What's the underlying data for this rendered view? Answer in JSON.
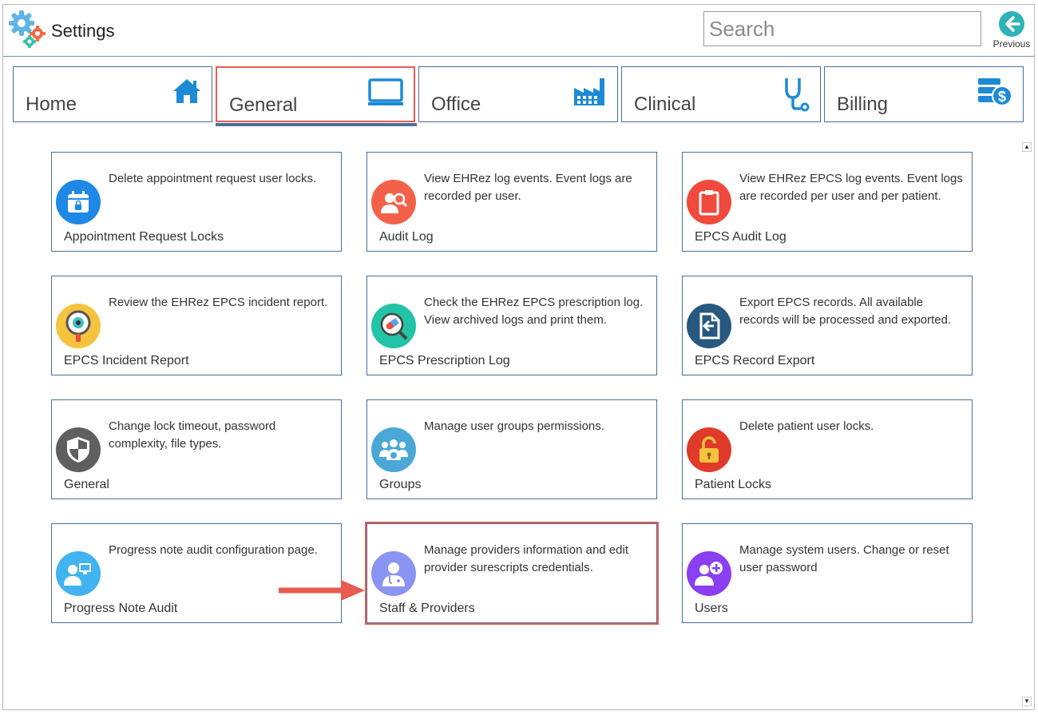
{
  "header": {
    "title": "Settings",
    "search_placeholder": "Search",
    "previous_label": "Previous"
  },
  "tabs": [
    {
      "label": "Home",
      "icon": "home-icon"
    },
    {
      "label": "General",
      "icon": "monitor-icon",
      "active": true
    },
    {
      "label": "Office",
      "icon": "factory-icon"
    },
    {
      "label": "Clinical",
      "icon": "stethoscope-icon"
    },
    {
      "label": "Billing",
      "icon": "billing-dollar-icon"
    }
  ],
  "cards": [
    {
      "title": "Appointment Request Locks",
      "desc": "Delete appointment request user locks.",
      "icon": "calendar-lock-icon",
      "color": "#1e88e5"
    },
    {
      "title": "Audit Log",
      "desc": "View EHRez log events. Event logs are recorded per user.",
      "icon": "user-search-icon",
      "color": "#f4614a"
    },
    {
      "title": "EPCS Audit Log",
      "desc": "View EHRez EPCS log events. Event logs are recorded per user and per patient.",
      "icon": "clipboard-icon",
      "color": "#ef4a3c"
    },
    {
      "title": "EPCS Incident Report",
      "desc": "Review the EHRez EPCS incident report.",
      "icon": "magnifier-eye-icon",
      "color": "#f6c33f"
    },
    {
      "title": "EPCS Prescription Log",
      "desc": "Check the EHRez EPCS prescription log. View archived logs and print them.",
      "icon": "pill-search-icon",
      "color": "#22c3a6"
    },
    {
      "title": "EPCS Record Export",
      "desc": "Export EPCS records. All available records will be processed and exported.",
      "icon": "file-export-icon",
      "color": "#27587f"
    },
    {
      "title": "General",
      "desc": "Change lock timeout, password complexity, file types.",
      "icon": "shield-icon",
      "color": "#5f5f5f"
    },
    {
      "title": "Groups",
      "desc": "Manage user groups permissions.",
      "icon": "user-group-icon",
      "color": "#4aa7d6"
    },
    {
      "title": "Patient Locks",
      "desc": "Delete patient user locks.",
      "icon": "padlock-icon",
      "color": "#e03a2a"
    },
    {
      "title": "Progress Note Audit",
      "desc": "Progress note audit configuration page.",
      "icon": "user-monitor-icon",
      "color": "#41b3f0"
    },
    {
      "title": "Staff & Providers",
      "desc": "Manage providers information and edit provider surescripts credentials.",
      "icon": "doctor-icon",
      "color": "#8a94f2",
      "highlighted": true
    },
    {
      "title": "Users",
      "desc": "Manage system users. Change or reset user password",
      "icon": "user-add-icon",
      "color": "#8a3ff0"
    }
  ],
  "colors": {
    "accent_border": "#4a6f9b",
    "highlight_red": "#e85b50",
    "previous_teal": "#2fb3b6"
  }
}
